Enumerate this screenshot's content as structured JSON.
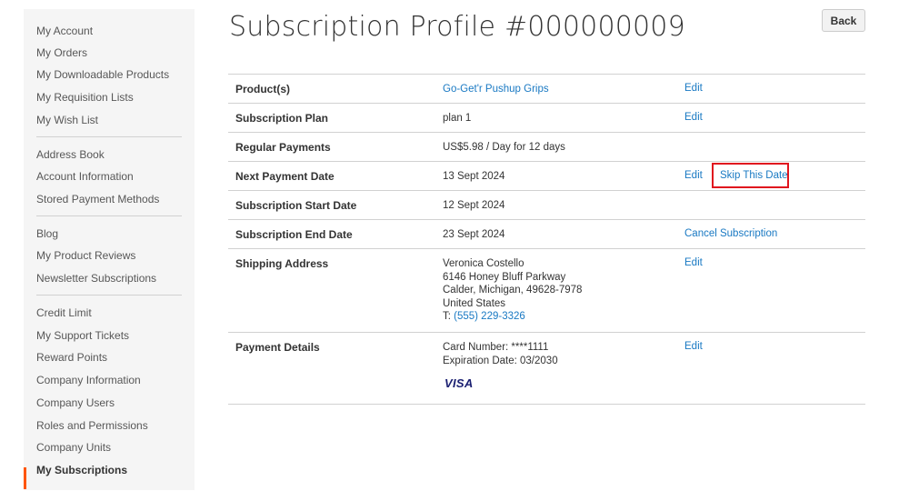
{
  "sidebar": {
    "items": [
      {
        "label": "My Account"
      },
      {
        "label": "My Orders"
      },
      {
        "label": "My Downloadable Products"
      },
      {
        "label": "My Requisition Lists"
      },
      {
        "label": "My Wish List"
      },
      {
        "label": "Address Book"
      },
      {
        "label": "Account Information"
      },
      {
        "label": "Stored Payment Methods"
      },
      {
        "label": "Blog"
      },
      {
        "label": "My Product Reviews"
      },
      {
        "label": "Newsletter Subscriptions"
      },
      {
        "label": "Credit Limit"
      },
      {
        "label": "My Support Tickets"
      },
      {
        "label": "Reward Points"
      },
      {
        "label": "Company Information"
      },
      {
        "label": "Company Users"
      },
      {
        "label": "Roles and Permissions"
      },
      {
        "label": "Company Units"
      },
      {
        "label": "My Subscriptions"
      }
    ],
    "active_item": "My Subscriptions",
    "accent_color": "#ff5501"
  },
  "header": {
    "title": "Subscription Profile #000000009",
    "back_label": "Back"
  },
  "profile": {
    "product": {
      "label": "Product(s)",
      "value": "Go-Get'r Pushup Grips",
      "action": "Edit"
    },
    "plan": {
      "label": "Subscription Plan",
      "value": "plan 1",
      "action": "Edit"
    },
    "regular_payments": {
      "label": "Regular Payments",
      "value": "US$5.98 / Day for 12 days"
    },
    "next_payment": {
      "label": "Next Payment Date",
      "value": "13 Sept 2024",
      "action": "Edit",
      "action2": "Skip This Date"
    },
    "start_date": {
      "label": "Subscription Start Date",
      "value": "12 Sept 2024"
    },
    "end_date": {
      "label": "Subscription End Date",
      "value": "23 Sept 2024",
      "action": "Cancel Subscription"
    },
    "shipping": {
      "label": "Shipping Address",
      "name": "Veronica Costello",
      "street": "6146 Honey Bluff Parkway",
      "city": "Calder, Michigan, 49628-7978",
      "country": "United States",
      "phone_prefix": "T: ",
      "phone": "(555) 229-3326",
      "action": "Edit"
    },
    "payment": {
      "label": "Payment Details",
      "card_number": "Card Number: ****1111",
      "expiration": "Expiration Date: 03/2030",
      "card_brand": "VISA",
      "action": "Edit"
    }
  },
  "colors": {
    "link": "#1979c3",
    "highlight_box": "#e0141e",
    "visa": "#1a1f71"
  }
}
